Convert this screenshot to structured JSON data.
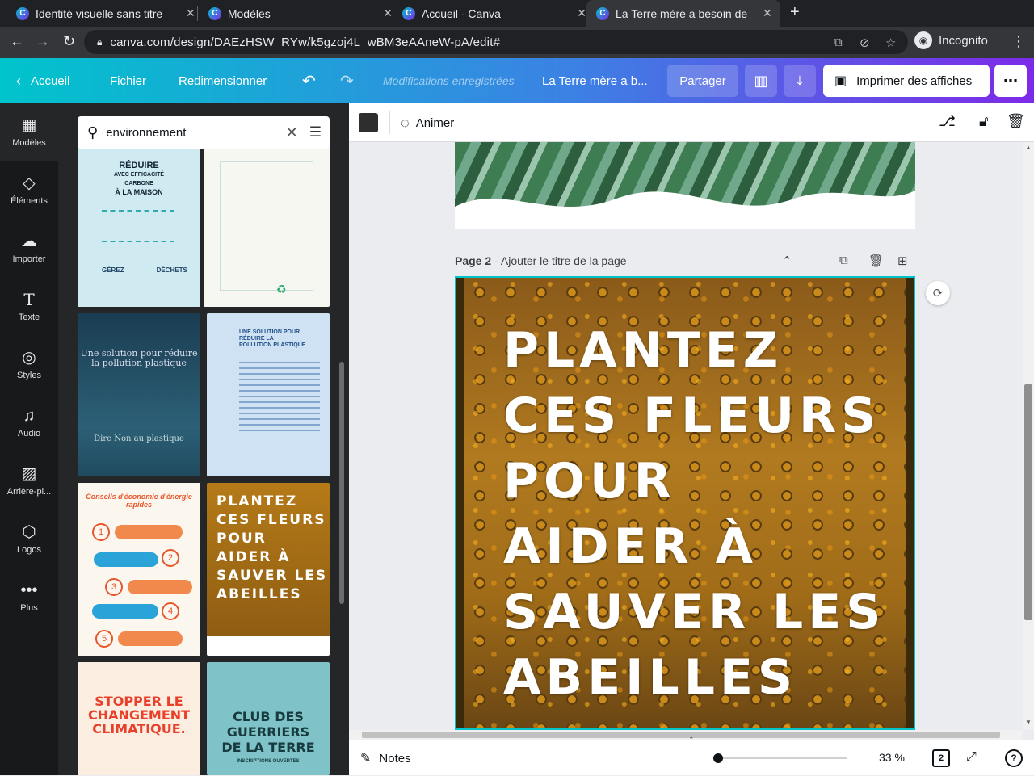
{
  "browser": {
    "tabs": [
      {
        "title": "Identité visuelle sans titre",
        "close": "✕"
      },
      {
        "title": "Modèles",
        "close": "✕"
      },
      {
        "title": "Accueil - Canva",
        "close": "✕"
      },
      {
        "title": "La Terre mère a besoin de",
        "close": "✕"
      }
    ],
    "new_tab": "+",
    "url": "canva.com/design/DAEzHSW_RYw/k5gzoj4L_wBM3eAAneW-pA/edit#",
    "profile": "Incognito"
  },
  "header": {
    "home": "Accueil",
    "file": "Fichier",
    "resize": "Redimensionner",
    "saved_status": "Modifications enregistrées",
    "doc_title": "La Terre mère a b...",
    "share": "Partager",
    "print": "Imprimer des affiches"
  },
  "rail": {
    "items": [
      {
        "label": "Modèles",
        "icon": "templates-icon"
      },
      {
        "label": "Éléments",
        "icon": "elements-icon"
      },
      {
        "label": "Importer",
        "icon": "upload-icon"
      },
      {
        "label": "Texte",
        "icon": "text-icon"
      },
      {
        "label": "Styles",
        "icon": "styles-icon"
      },
      {
        "label": "Audio",
        "icon": "audio-icon"
      },
      {
        "label": "Arrière-pl...",
        "icon": "background-icon"
      },
      {
        "label": "Logos",
        "icon": "logos-icon"
      },
      {
        "label": "Plus",
        "icon": "more-icon"
      }
    ]
  },
  "panel": {
    "search_value": "environnement",
    "templates": [
      {
        "lines": [
          "RÉDUIRE",
          "AVEC EFFICACITÉ",
          "CARBONE",
          "À LA MAISON"
        ],
        "footer": [
          "GÉREZ",
          "DÉCHETS"
        ]
      },
      {
        "lines": [
          "Une solution pour réduire",
          "la pollution plastique"
        ],
        "footer": [
          "Dire Non au plastique"
        ]
      },
      {
        "lines": [
          "UNE SOLUTION POUR",
          "RÉDUIRE LA",
          "POLLUTION PLASTIQUE"
        ]
      },
      {
        "lines": [
          "Conseils d'économie d'énergie rapides"
        ],
        "numbers": [
          "1",
          "2",
          "3",
          "4",
          "5"
        ]
      },
      {
        "lines": [
          "PLANTEZ",
          "CES FLEURS",
          "POUR",
          "AIDER À",
          "SAUVER LES",
          "ABEILLES"
        ]
      },
      {
        "lines": [
          "STOPPER LE",
          "CHANGEMENT",
          "CLIMATIQUE."
        ]
      },
      {
        "lines": [
          "CLUB DES",
          "GUERRIERS",
          "DE LA TERRE"
        ],
        "footer": [
          "INSCRIPTIONS OUVERTES"
        ]
      }
    ]
  },
  "toolbar": {
    "animate": "Animer",
    "text_color": "#2e2e2e"
  },
  "canvas": {
    "page2_label": "Page 2",
    "page2_title_placeholder": "- Ajouter le titre de la page",
    "poster_lines": [
      "PLANTEZ",
      "CES FLEURS",
      "POUR",
      "AIDER À",
      "SAUVER LES",
      "ABEILLES"
    ]
  },
  "footer": {
    "notes": "Notes",
    "zoom": "33 %",
    "page_count": "2",
    "help": "?"
  },
  "colors": {
    "accent": "#00c4cc",
    "brand_purple": "#7d2ae8"
  }
}
